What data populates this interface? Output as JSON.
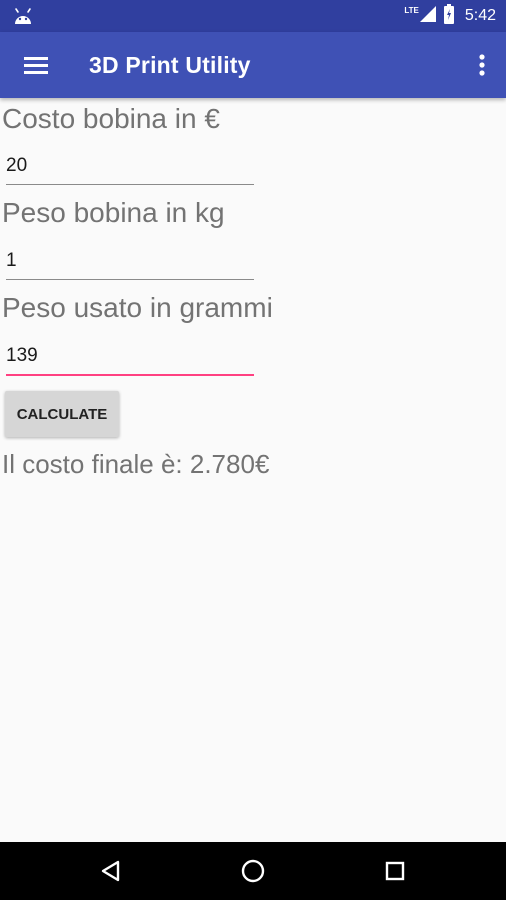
{
  "status_bar": {
    "network": "LTE",
    "time": "5:42",
    "icons": [
      "android-icon",
      "signal-icon",
      "battery-icon"
    ]
  },
  "app_bar": {
    "title": "3D Print Utility",
    "icons": [
      "menu-icon",
      "more-vert-icon"
    ],
    "color": "#3f51b5"
  },
  "form": {
    "spool_cost": {
      "label": "Costo bobina in €",
      "value": "20"
    },
    "spool_weight": {
      "label": "Peso bobina in kg",
      "value": "1"
    },
    "used_weight": {
      "label": "Peso usato in grammi",
      "value": "139"
    },
    "calculate_label": "CALCULATE",
    "result": "Il costo finale è: 2.780€"
  },
  "nav_bar": {
    "icons": [
      "back-icon",
      "home-icon",
      "recents-icon"
    ]
  },
  "colors": {
    "status_bar": "#303f9f",
    "accent": "#ff4081"
  }
}
